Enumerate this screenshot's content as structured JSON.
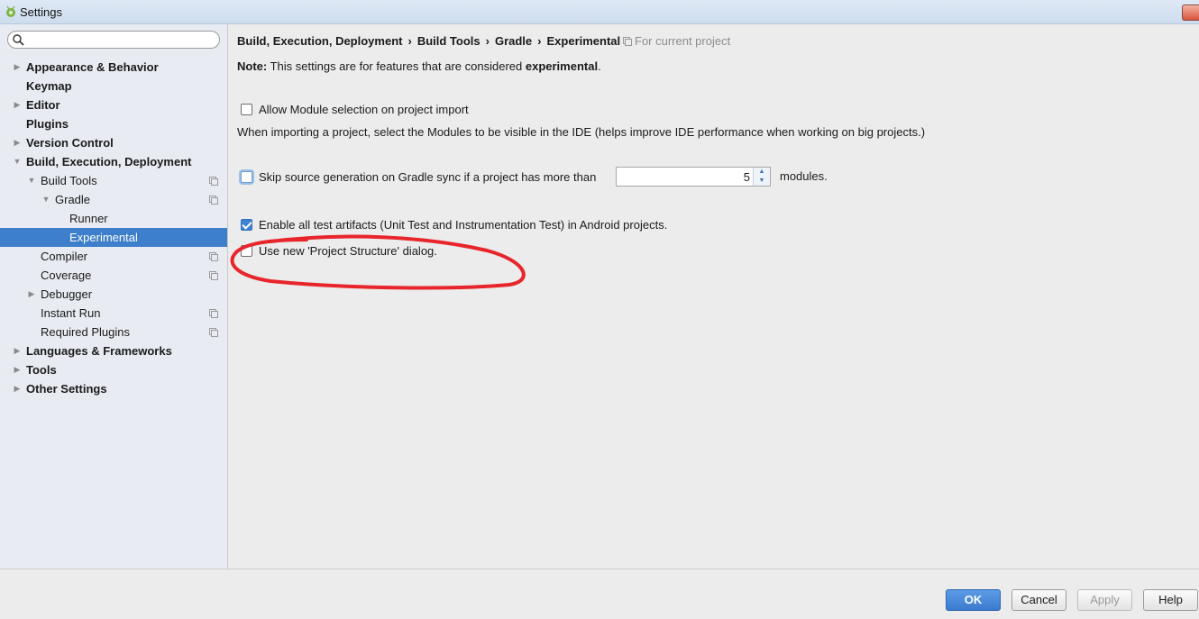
{
  "window": {
    "title": "Settings"
  },
  "search": {
    "placeholder": ""
  },
  "sidebar": {
    "items": [
      {
        "label": "Appearance & Behavior",
        "level": 0,
        "bold": true,
        "arrow": "right",
        "proj": false,
        "selected": false
      },
      {
        "label": "Keymap",
        "level": 0,
        "bold": true,
        "arrow": "",
        "proj": false,
        "selected": false
      },
      {
        "label": "Editor",
        "level": 0,
        "bold": true,
        "arrow": "right",
        "proj": false,
        "selected": false
      },
      {
        "label": "Plugins",
        "level": 0,
        "bold": true,
        "arrow": "",
        "proj": false,
        "selected": false
      },
      {
        "label": "Version Control",
        "level": 0,
        "bold": true,
        "arrow": "right",
        "proj": false,
        "selected": false
      },
      {
        "label": "Build, Execution, Deployment",
        "level": 0,
        "bold": true,
        "arrow": "down",
        "proj": false,
        "selected": false
      },
      {
        "label": "Build Tools",
        "level": 1,
        "bold": false,
        "arrow": "down",
        "proj": true,
        "selected": false
      },
      {
        "label": "Gradle",
        "level": 2,
        "bold": false,
        "arrow": "down",
        "proj": true,
        "selected": false
      },
      {
        "label": "Runner",
        "level": 3,
        "bold": false,
        "arrow": "",
        "proj": false,
        "selected": false
      },
      {
        "label": "Experimental",
        "level": 3,
        "bold": false,
        "arrow": "",
        "proj": false,
        "selected": true
      },
      {
        "label": "Compiler",
        "level": 1,
        "bold": false,
        "arrow": "",
        "proj": true,
        "selected": false
      },
      {
        "label": "Coverage",
        "level": 1,
        "bold": false,
        "arrow": "",
        "proj": true,
        "selected": false
      },
      {
        "label": "Debugger",
        "level": 1,
        "bold": false,
        "arrow": "right",
        "proj": false,
        "selected": false
      },
      {
        "label": "Instant Run",
        "level": 1,
        "bold": false,
        "arrow": "",
        "proj": true,
        "selected": false
      },
      {
        "label": "Required Plugins",
        "level": 1,
        "bold": false,
        "arrow": "",
        "proj": true,
        "selected": false
      },
      {
        "label": "Languages & Frameworks",
        "level": 0,
        "bold": true,
        "arrow": "right",
        "proj": false,
        "selected": false
      },
      {
        "label": "Tools",
        "level": 0,
        "bold": true,
        "arrow": "right",
        "proj": false,
        "selected": false
      },
      {
        "label": "Other Settings",
        "level": 0,
        "bold": true,
        "arrow": "right",
        "proj": false,
        "selected": false
      }
    ]
  },
  "breadcrumb": {
    "parts": [
      "Build, Execution, Deployment",
      "Build Tools",
      "Gradle",
      "Experimental"
    ],
    "separator": "›",
    "scope": "For current project"
  },
  "note": {
    "prefix": "Note:",
    "text": " This settings are for features that are considered ",
    "emphasis": "experimental",
    "suffix": "."
  },
  "options": {
    "module_selection": {
      "label": "Allow Module selection on project import",
      "checked": false
    },
    "module_selection_desc": "When importing a project, select the Modules to be visible in the IDE (helps improve IDE performance when working on big projects.)",
    "skip_source": {
      "label": "Skip source generation on Gradle sync if a project has more than",
      "checked": false,
      "value": "5",
      "suffix": "modules."
    },
    "test_artifacts": {
      "label": "Enable all test artifacts (Unit Test and Instrumentation Test) in Android projects.",
      "checked": true
    },
    "project_structure": {
      "label": "Use new 'Project Structure' dialog.",
      "checked": false
    }
  },
  "buttons": {
    "ok": "OK",
    "cancel": "Cancel",
    "apply": "Apply",
    "help": "Help"
  },
  "colors": {
    "selection": "#3d7fca",
    "annotation": "#e8252b",
    "primary": "#3a7bd0"
  }
}
